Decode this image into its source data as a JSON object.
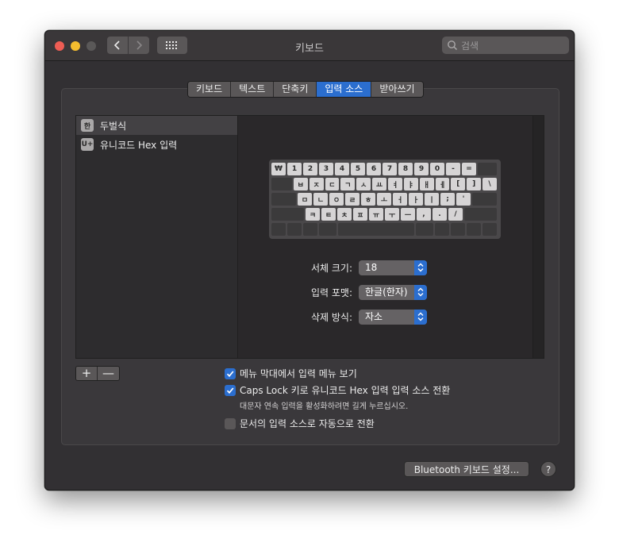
{
  "window": {
    "title": "키보드"
  },
  "search": {
    "placeholder": "검색"
  },
  "tabs": [
    {
      "label": "키보드",
      "active": false
    },
    {
      "label": "텍스트",
      "active": false
    },
    {
      "label": "단축키",
      "active": false
    },
    {
      "label": "입력 소스",
      "active": true
    },
    {
      "label": "받아쓰기",
      "active": false
    }
  ],
  "sources": [
    {
      "icon": "한",
      "label": "두벌식",
      "selected": true
    },
    {
      "icon": "U+",
      "label": "유니코드 Hex 입력",
      "selected": false
    }
  ],
  "keyboard": {
    "row1": [
      "₩",
      "1",
      "2",
      "3",
      "4",
      "5",
      "6",
      "7",
      "8",
      "9",
      "0",
      "-",
      "="
    ],
    "row2": [
      "ㅂ",
      "ㅈ",
      "ㄷ",
      "ㄱ",
      "ㅅ",
      "ㅛ",
      "ㅕ",
      "ㅑ",
      "ㅐ",
      "ㅔ",
      "[",
      "]",
      "\\"
    ],
    "row3": [
      "ㅁ",
      "ㄴ",
      "ㅇ",
      "ㄹ",
      "ㅎ",
      "ㅗ",
      "ㅓ",
      "ㅏ",
      "ㅣ",
      ";",
      "'"
    ],
    "row4": [
      "ㅋ",
      "ㅌ",
      "ㅊ",
      "ㅍ",
      "ㅠ",
      "ㅜ",
      "ㅡ",
      ",",
      ".",
      "/"
    ]
  },
  "form": {
    "font_size_label": "서체 크기:",
    "font_size_value": "18",
    "input_format_label": "입력 포맷:",
    "input_format_value": "한글(한자)",
    "delete_mode_label": "삭제 방식:",
    "delete_mode_value": "자소"
  },
  "buttons": {
    "add": "+",
    "remove": "—",
    "bluetooth": "Bluetooth 키보드 설정...",
    "help": "?"
  },
  "options": {
    "show_menu": {
      "label": "메뉴 막대에서 입력 메뉴 보기",
      "checked": true
    },
    "caps_lock": {
      "label": "Caps Lock 키로 유니코드 Hex 입력 입력 소스 전환",
      "checked": true
    },
    "caps_lock_hint": "대문자 연속 입력을 활성화하려면 길게 누르십시오.",
    "auto_switch": {
      "label": "문서의 입력 소스로 자동으로 전환",
      "checked": false
    }
  }
}
